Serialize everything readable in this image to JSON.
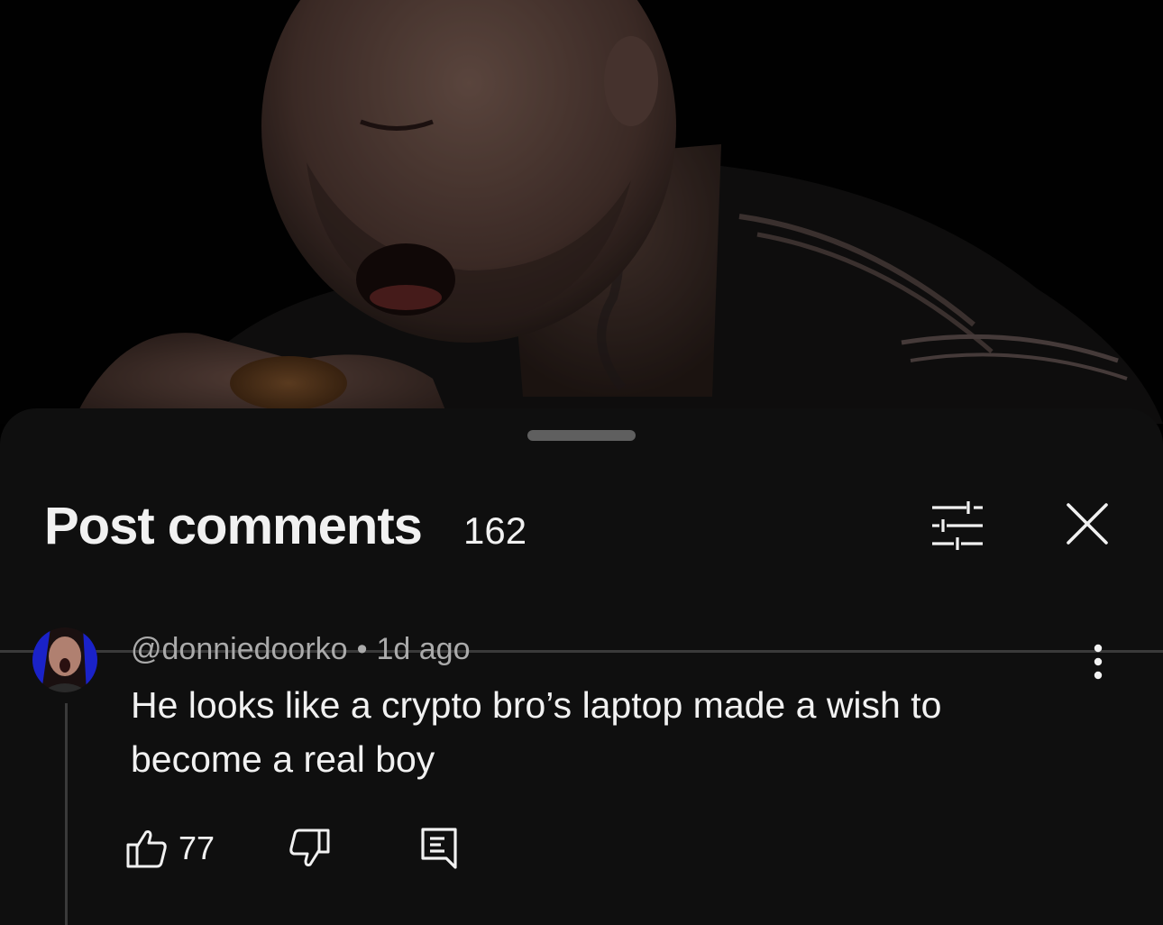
{
  "comments_panel": {
    "title": "Post comments",
    "count": "162",
    "icons": {
      "filter": "sort-filter-icon",
      "close": "close-icon"
    }
  },
  "comment": {
    "author": "@donniedoorko",
    "separator": "•",
    "time": "1d ago",
    "text": "He looks like a crypto bro’s laptop made a wish to become a real boy",
    "likes": "77",
    "icons": {
      "like": "thumbs-up-icon",
      "dislike": "thumbs-down-icon",
      "reply": "reply-icon",
      "more": "more-vertical-icon"
    }
  },
  "colors": {
    "sheet_background": "#0f0f0f",
    "primary_text": "#f1f1f1",
    "secondary_text": "#aaaaaa",
    "divider": "#3a3a3a"
  }
}
